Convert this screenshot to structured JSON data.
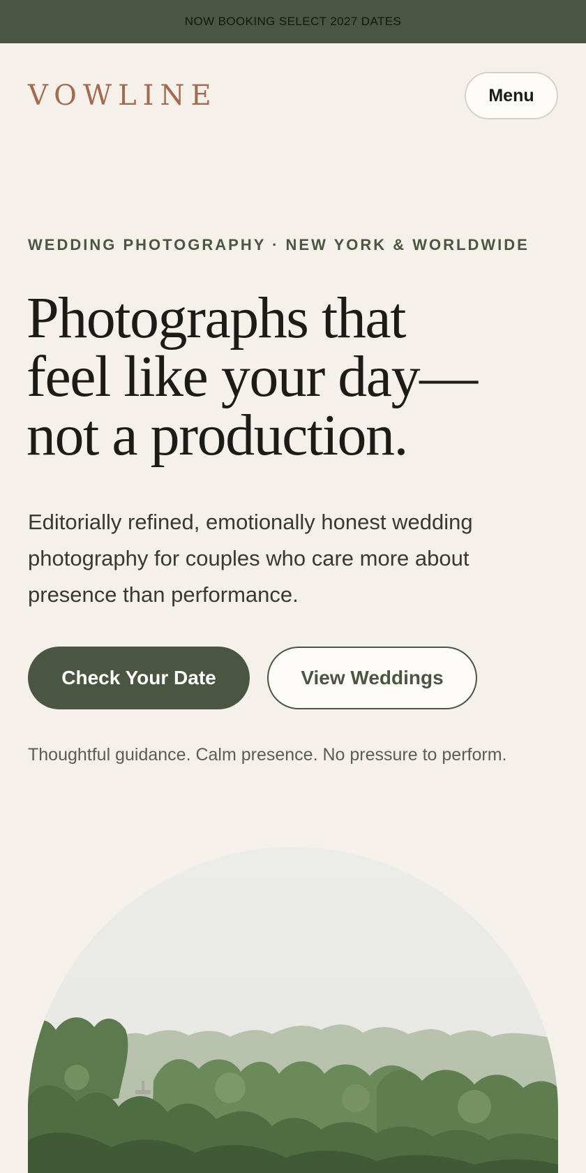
{
  "announcement": {
    "text": "NOW BOOKING SELECT 2027 DATES"
  },
  "header": {
    "logo": "VOWLINE",
    "menu_label": "Menu"
  },
  "hero": {
    "eyebrow": "WEDDING PHOTOGRAPHY · NEW YORK & WORLDWIDE",
    "headline_lines": [
      "Photographs that",
      "feel like your day—",
      "not a production."
    ],
    "intro": "Editorially refined, emotionally honest wedding photography for couples who care more about presence than performance.",
    "primary_cta": "Check Your Date",
    "secondary_cta": "View Weddings",
    "tagline": "Thoughtful guidance. Calm presence. No pressure to perform."
  },
  "colors": {
    "background": "#f5f0ea",
    "accent_green": "#4a5642",
    "logo_terracotta": "#a36a4f"
  }
}
